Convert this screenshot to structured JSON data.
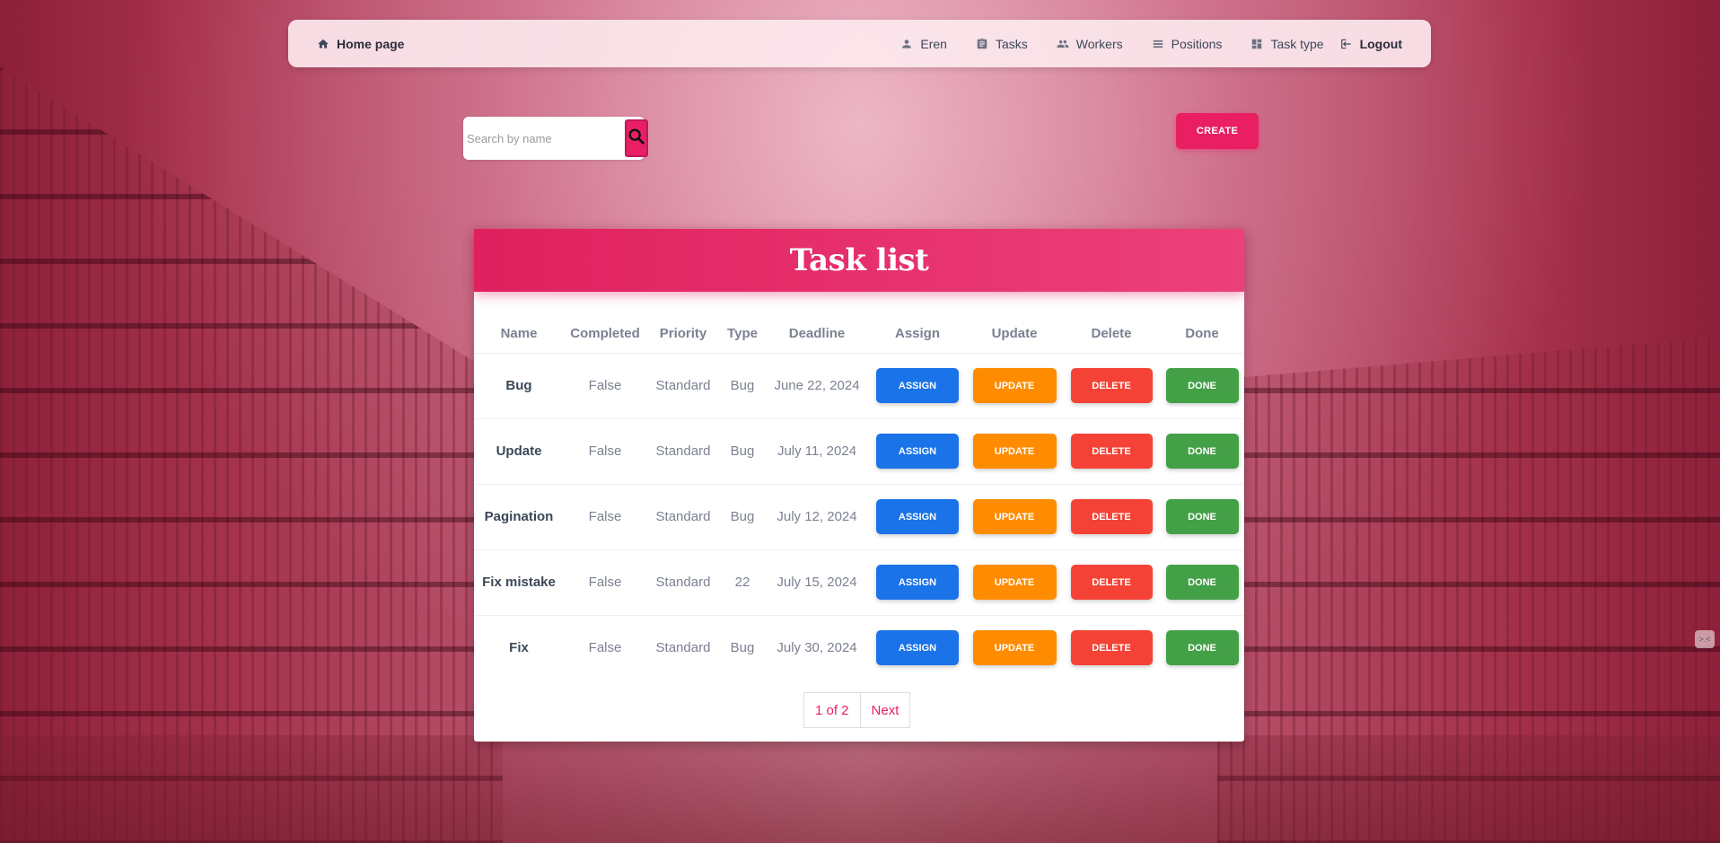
{
  "nav": {
    "home_label": "Home page",
    "items": [
      {
        "label": "Eren",
        "icon": "person-icon"
      },
      {
        "label": "Tasks",
        "icon": "clipboard-icon"
      },
      {
        "label": "Workers",
        "icon": "group-icon"
      },
      {
        "label": "Positions",
        "icon": "list-icon"
      },
      {
        "label": "Task type",
        "icon": "dashboard-icon"
      }
    ],
    "logout_label": "Logout"
  },
  "search": {
    "placeholder": "Search by name"
  },
  "create_label": "CREATE",
  "card": {
    "title": "Task list"
  },
  "table": {
    "headers": [
      "Name",
      "Completed",
      "Priority",
      "Type",
      "Deadline",
      "Assign",
      "Update",
      "Delete",
      "Done"
    ],
    "rows": [
      {
        "name": "Bug",
        "completed": "False",
        "priority": "Standard",
        "type": "Bug",
        "deadline": "June 22, 2024"
      },
      {
        "name": "Update",
        "completed": "False",
        "priority": "Standard",
        "type": "Bug",
        "deadline": "July 11, 2024"
      },
      {
        "name": "Pagination",
        "completed": "False",
        "priority": "Standard",
        "type": "Bug",
        "deadline": "July 12, 2024"
      },
      {
        "name": "Fix mistake",
        "completed": "False",
        "priority": "Standard",
        "type": "22",
        "deadline": "July 15, 2024"
      },
      {
        "name": "Fix",
        "completed": "False",
        "priority": "Standard",
        "type": "Bug",
        "deadline": "July 30, 2024"
      }
    ],
    "actions": {
      "assign": "ASSIGN",
      "update": "UPDATE",
      "delete": "DELETE",
      "done": "DONE"
    }
  },
  "pagination": {
    "current": "1 of 2",
    "next": "Next"
  },
  "colors": {
    "accent": "#e91e63",
    "assign": "#1a73e8",
    "update": "#ff8c00",
    "delete": "#f44336",
    "done": "#43a047"
  }
}
